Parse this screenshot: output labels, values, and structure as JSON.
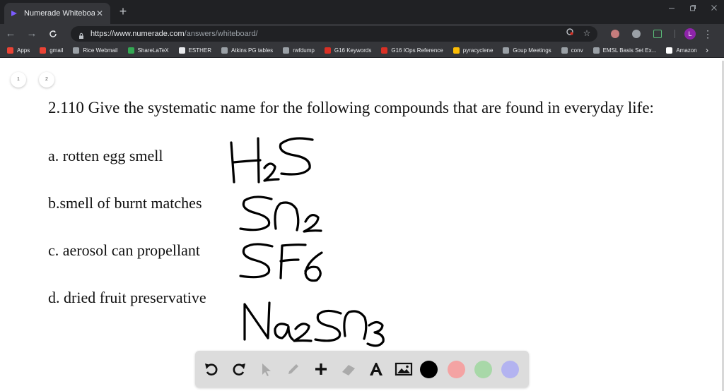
{
  "browser": {
    "tab_title": "Numerade Whiteboard",
    "tab_close": "✕",
    "new_tab": "+",
    "url_host": "https://www.numerade.com",
    "url_path": "/answers/whiteboard/",
    "profile_initial": "L",
    "bookmarks": [
      {
        "label": "Apps",
        "color": "#ea4335"
      },
      {
        "label": "gmail",
        "color": "#ea4335"
      },
      {
        "label": "Rice Webmail",
        "color": "#9aa0a6"
      },
      {
        "label": "ShareLaTeX",
        "color": "#34a853"
      },
      {
        "label": "ESTHER",
        "color": "#e8eaed"
      },
      {
        "label": "Atkins PG tables",
        "color": "#9aa0a6"
      },
      {
        "label": "rwfdump",
        "color": "#9aa0a6"
      },
      {
        "label": "G16 Keywords",
        "color": "#d93025"
      },
      {
        "label": "G16 IOps Reference",
        "color": "#d93025"
      },
      {
        "label": "pyracyclene",
        "color": "#fbbc04"
      },
      {
        "label": "Goup Meetings",
        "color": "#9aa0a6"
      },
      {
        "label": "conv",
        "color": "#9aa0a6"
      },
      {
        "label": "EMSL Basis Set Ex...",
        "color": "#9aa0a6"
      },
      {
        "label": "Amazon",
        "color": "#ffffff"
      }
    ]
  },
  "whiteboard": {
    "pages": [
      "1",
      "2"
    ],
    "question_title": "2.110 Give the systematic name for the following compounds that are found in everyday life:",
    "items": [
      {
        "label": "a. rotten egg smell",
        "answer": "H2S"
      },
      {
        "label": "b.smell of burnt matches",
        "answer": "SO2"
      },
      {
        "label": "c. aerosol can propellant",
        "answer": "SF6"
      },
      {
        "label": "d. dried fruit preservative",
        "answer": "Na2SO3"
      }
    ],
    "tools": [
      "undo-icon",
      "redo-icon",
      "pointer-icon",
      "pencil-icon",
      "add-icon",
      "eraser-icon",
      "text-icon",
      "image-icon"
    ],
    "colors": [
      "#000000",
      "#f4a3a3",
      "#a8d8a8",
      "#b3b3f0"
    ]
  }
}
